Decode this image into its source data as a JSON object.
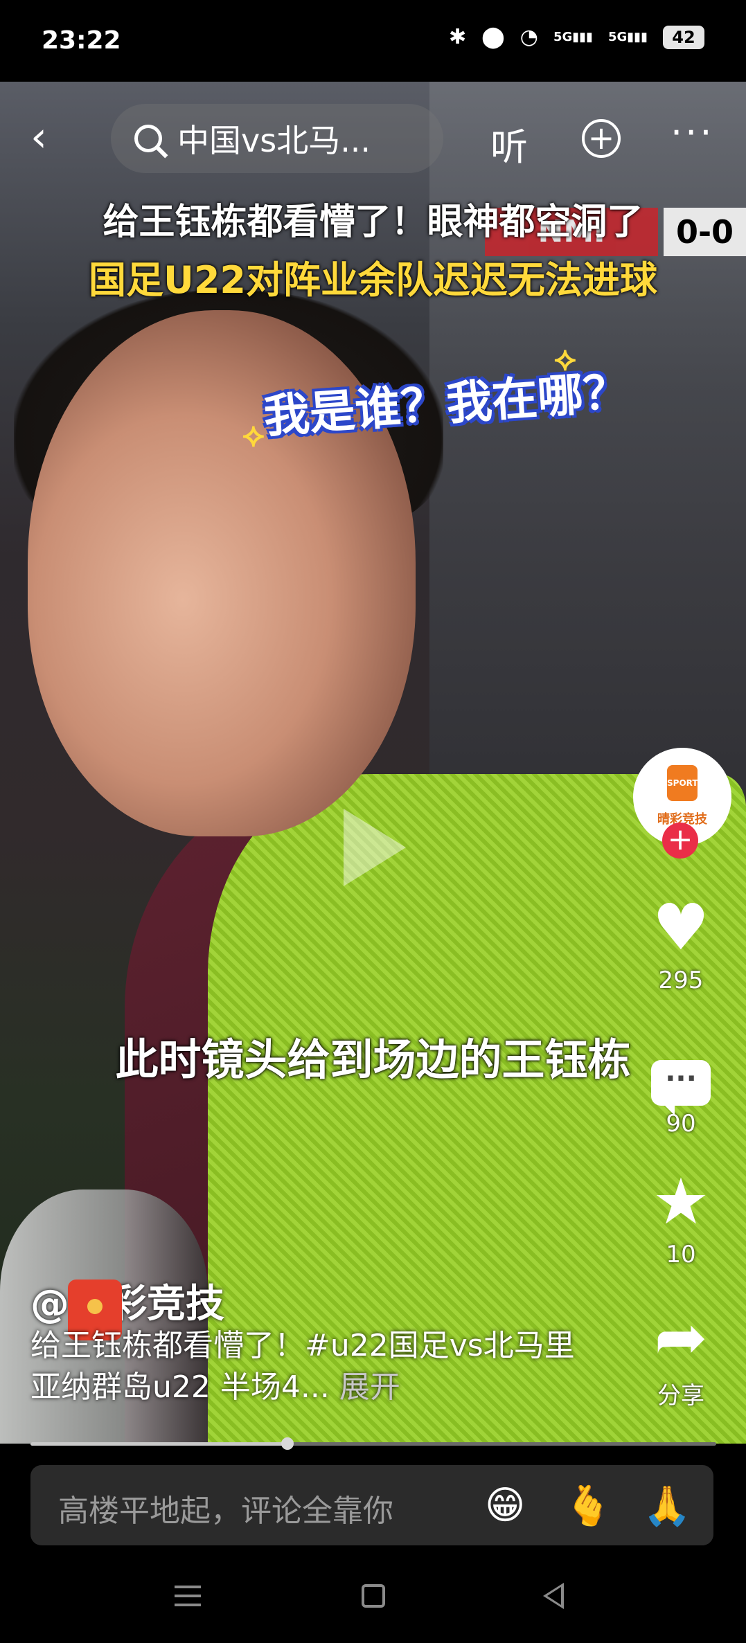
{
  "status_bar": {
    "time": "23:22",
    "signal1": "5G",
    "signal2": "5G",
    "battery": "42"
  },
  "top_bar": {
    "search_text": "中国vs北马...",
    "listen_label": "听"
  },
  "video": {
    "caption_line1": "给王钰栋都看懵了！眼神都空洞了",
    "caption_line2": "国足U22对阵业余队迟迟无法进球",
    "score_team": "NMI",
    "score": "0-0",
    "bubble_text": "我是谁？我在哪？",
    "subtitle": "此时镜头给到场边的王钰栋",
    "progress_fraction": 0.375
  },
  "right_rail": {
    "avatar_logo": "SPORT",
    "avatar_name": "晴彩竞技",
    "likes": "295",
    "comments": "90",
    "favorites": "10",
    "share_label": "分享"
  },
  "post": {
    "author": "@晴彩竞技",
    "description": "给王钰栋都看懵了！#u22国足vs北马里亚纳群岛u22 半场4...",
    "expand_label": "展开"
  },
  "comment_bar": {
    "placeholder": "高楼平地起，评论全靠你",
    "emoji1": "😁",
    "emoji2": "🫰",
    "emoji3": "🙏"
  },
  "colors": {
    "accent_red": "#ea2e48",
    "caption_yellow": "#ffd93b"
  }
}
